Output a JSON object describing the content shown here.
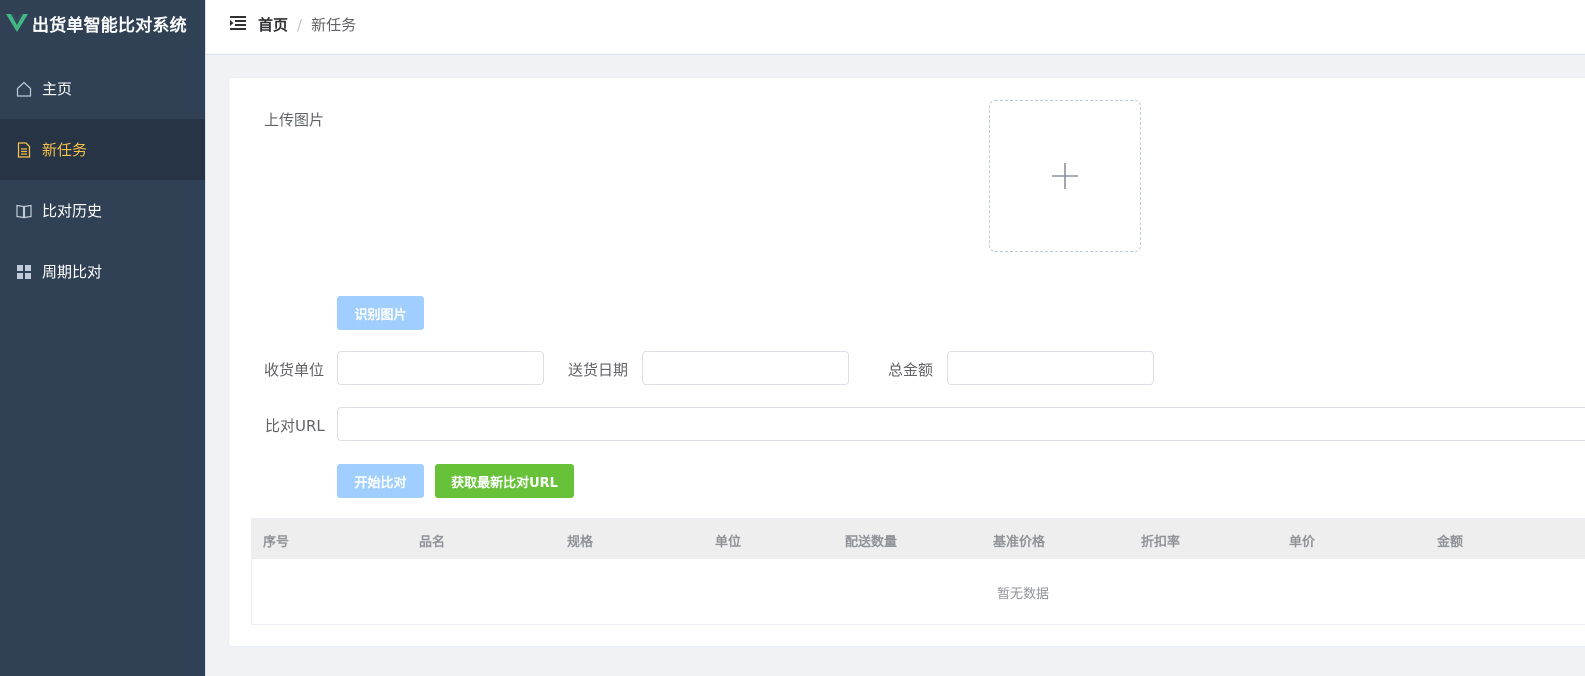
{
  "app": {
    "title": "出货单智能比对系统",
    "brand_color": "#41b883"
  },
  "sidebar": {
    "items": [
      {
        "label": "主页",
        "icon": "home-icon",
        "active": false
      },
      {
        "label": "新任务",
        "icon": "document-icon",
        "active": true
      },
      {
        "label": "比对历史",
        "icon": "book-icon",
        "active": false
      },
      {
        "label": "周期比对",
        "icon": "grid-icon",
        "active": false
      }
    ]
  },
  "header": {
    "breadcrumb": {
      "home": "首页",
      "separator": "/",
      "current": "新任务"
    }
  },
  "form": {
    "upload_label": "上传图片",
    "recognize_button": "识别图片",
    "receiver_label": "收货单位",
    "receiver_value": "",
    "delivery_date_label": "送货日期",
    "delivery_date_value": "",
    "total_amount_label": "总金额",
    "total_amount_value": "",
    "url_label": "比对URL",
    "url_value": "",
    "start_compare_button": "开始比对",
    "fetch_url_button": "获取最新比对URL"
  },
  "table": {
    "columns": [
      "序号",
      "品名",
      "规格",
      "单位",
      "配送数量",
      "基准价格",
      "折扣率",
      "单价",
      "金额"
    ],
    "rows": [],
    "empty_text": "暂无数据"
  },
  "colors": {
    "sidebar_bg": "#304156",
    "active_menu_text": "#f4c049",
    "disabled_button": "#a0cfff",
    "success_button": "#67c23a"
  }
}
